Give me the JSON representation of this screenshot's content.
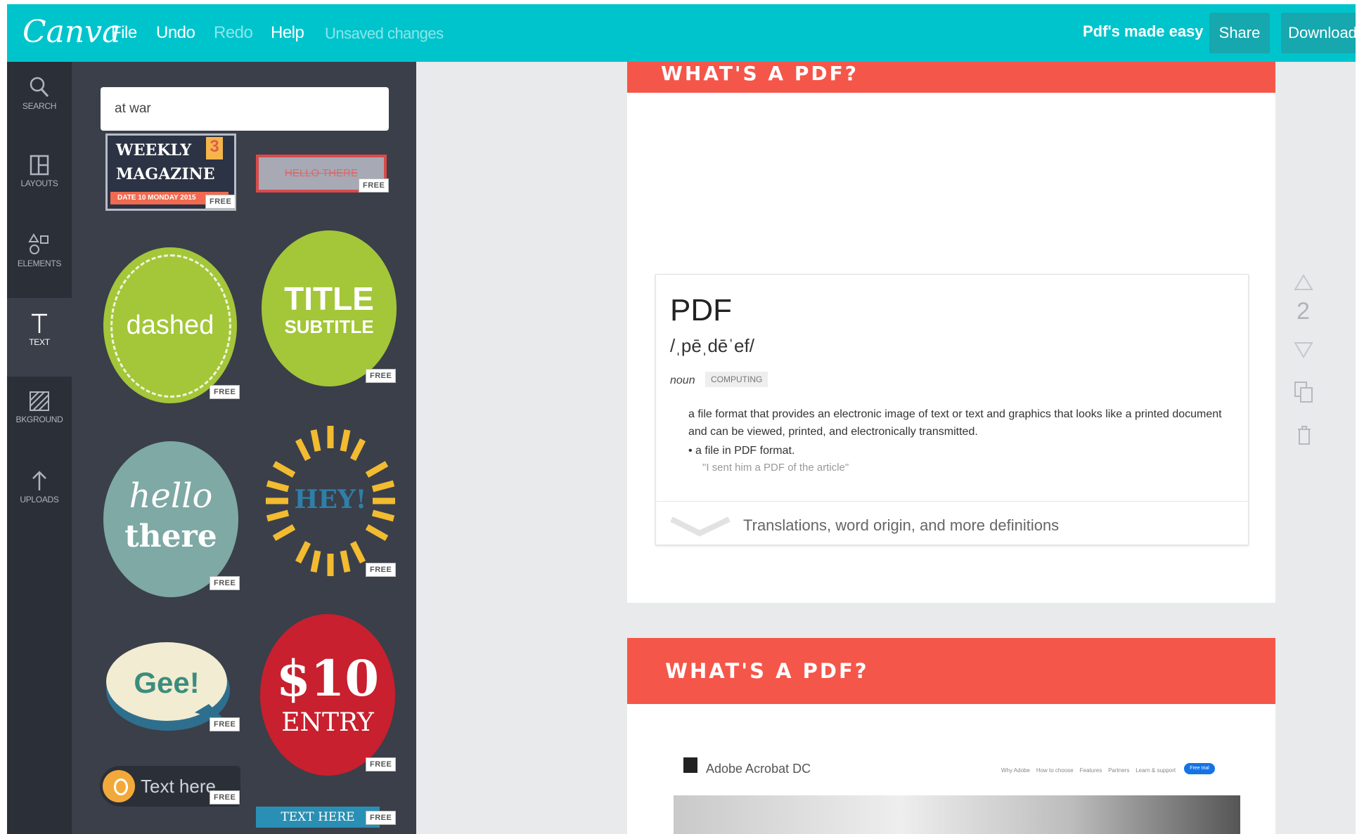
{
  "topbar": {
    "logo": "Canva",
    "menu": {
      "file": "File",
      "undo": "Undo",
      "redo": "Redo",
      "help": "Help",
      "status": "Unsaved changes"
    },
    "doc_title": "Pdf's made easy",
    "share": "Share",
    "download": "Download"
  },
  "rail": [
    {
      "label": "SEARCH",
      "icon": "search-icon"
    },
    {
      "label": "LAYOUTS",
      "icon": "layouts-icon"
    },
    {
      "label": "ELEMENTS",
      "icon": "elements-icon"
    },
    {
      "label": "TEXT",
      "icon": "text-icon"
    },
    {
      "label": "BKGROUND",
      "icon": "background-icon"
    },
    {
      "label": "UPLOADS",
      "icon": "upload-icon"
    }
  ],
  "panel": {
    "search_value": "at war",
    "free": "FREE",
    "tiles": {
      "weekly": "WEEKLY",
      "magazine": "MAGAZINE",
      "num": "3",
      "date": "DATE 10 MONDAY 2015",
      "hello_box": "HELLO THERE",
      "dashed": "dashed",
      "title": "TITLE",
      "subtitle": "SUBTITLE",
      "hello": "hello",
      "there": "there",
      "hey": "HEY!",
      "gee": "Gee!",
      "price": "$10",
      "entry": "ENTRY",
      "text_here": "Text here",
      "text_here_ribbon": "TEXT HERE"
    }
  },
  "canvas": {
    "page1_banner": "WHAT'S A PDF?",
    "page2_banner": "WHAT'S A PDF?",
    "definition": {
      "word": "PDF",
      "pronunciation": "/ˌpēˌdēˈef/",
      "pos": "noun",
      "tag": "COMPUTING",
      "meaning": "a file format that provides an electronic image of text or text and graphics that looks like a printed document and can be viewed, printed, and electronically transmitted.",
      "sub_meaning": "a file in PDF format.",
      "example": "\"I sent him a PDF of the article\"",
      "more": "Translations, word origin, and more definitions"
    },
    "acrobat": {
      "title": "Adobe Acrobat DC",
      "nav": [
        "Why Adobe",
        "How to choose",
        "Features",
        "Partners",
        "Learn & support"
      ],
      "cta": "Free trial"
    },
    "page_number": "2"
  },
  "colors": {
    "topbar": "#00c4cc",
    "rail": "#2b2f38",
    "panel": "#3a3f4a",
    "banner": "#f5564a",
    "workspace": "#e9eaeb"
  }
}
